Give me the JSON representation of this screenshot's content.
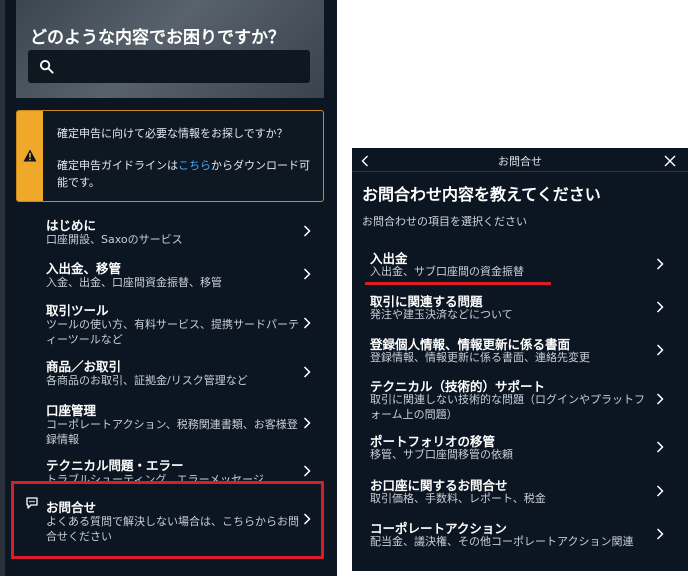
{
  "left_panel": {
    "hero_title": "どのような内容でお困りですか？",
    "search": {
      "placeholder": ""
    },
    "notice": {
      "question": "確定申告に向けて必要な情報をお探しですか？",
      "text_before_link": "確定申告ガイドラインは",
      "link_label": "こちら",
      "text_after_link": "からダウンロード可能です。"
    },
    "items": [
      {
        "title": "はじめに",
        "desc": "口座開設、Saxoのサービス"
      },
      {
        "title": "入出金、移管",
        "desc": "入金、出金、口座間資金振替、移管"
      },
      {
        "title": "取引ツール",
        "desc": "ツールの使い方、有料サービス、提携サードパーティーツールなど"
      },
      {
        "title": "商品／お取引",
        "desc": "各商品のお取引、証拠金/リスク管理など"
      },
      {
        "title": "口座管理",
        "desc": "コーポレートアクション、税務関連書類、お客様登録情報"
      },
      {
        "title": "テクニカル問題・エラー",
        "desc": "トラブルシューティング、エラーメッセージ"
      },
      {
        "title": "お問合せ",
        "desc": "よくある質問で解決しない場合は、こちらからお問合せください"
      }
    ]
  },
  "right_panel": {
    "header_title": "お問合せ",
    "title": "お問合わせ内容を教えてください",
    "subtitle": "お問合わせの項目を選択ください",
    "items": [
      {
        "title": "入出金",
        "desc": "入出金、サブ口座間の資金振替"
      },
      {
        "title": "取引に関連する問題",
        "desc": "発注や建玉決済などについて"
      },
      {
        "title": "登録個人情報、情報更新に係る書面",
        "desc": "登録情報、情報更新に係る書面、連絡先変更"
      },
      {
        "title": "テクニカル（技術的）サポート",
        "desc": "取引に関連しない技術的な問題（ログインやプラットフォーム上の問題）"
      },
      {
        "title": "ポートフォリオの移管",
        "desc": "移管、サブ口座間移管の依頼"
      },
      {
        "title": "お口座に関するお問合せ",
        "desc": "取引価格、手数料、レポート、税金"
      },
      {
        "title": "コーポレートアクション",
        "desc": "配当金、議決権、その他コーポレートアクション関連"
      }
    ]
  },
  "colors": {
    "background": "#0b1622",
    "highlight_red": "#d91c26",
    "notice_orange": "#f0a82a",
    "link_blue": "#4da3ff"
  },
  "icons": [
    "search-icon",
    "warning-icon",
    "chevron-right-icon",
    "chat-icon",
    "back-icon",
    "close-icon"
  ]
}
